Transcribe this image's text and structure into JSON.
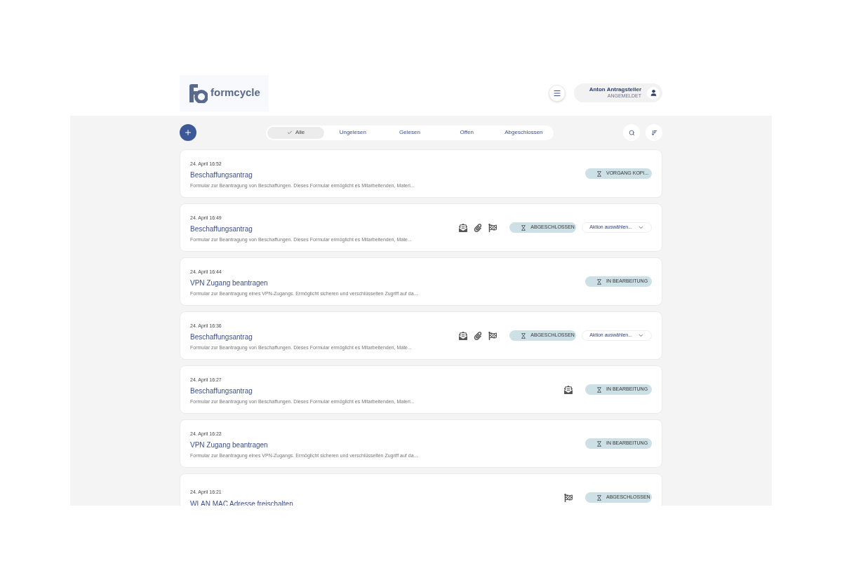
{
  "header": {
    "logo_text": "formcycle",
    "user": {
      "name": "Anton Antragsteller",
      "status": "ANGEMELDET"
    }
  },
  "filters": [
    {
      "label": "Alle",
      "selected": true
    },
    {
      "label": "Ungelesen",
      "selected": false
    },
    {
      "label": "Gelesen",
      "selected": false
    },
    {
      "label": "Offen",
      "selected": false
    },
    {
      "label": "Abgeschlossen",
      "selected": false
    }
  ],
  "entries": [
    {
      "date": "24. April 16:52",
      "title": "Beschaffungsantrag",
      "description": "Formular zur Beantragung von Beschaffungen. Dieses Formular ermöglicht es Mitarbeitenden, Materi...",
      "mail": false,
      "attachment": false,
      "flag": false,
      "status": "VORGANG KOPI..."
    },
    {
      "date": "24. April 16:49",
      "title": "Beschaffungsantrag",
      "description": "Formular zur Beantragung von Beschaffungen. Dieses Formular ermöglicht es Mitarbeitenden, Mate...",
      "mail": true,
      "attachment": true,
      "flag": true,
      "status": "ABGESCHLOSSEN",
      "action": "Aktion auswählen..."
    },
    {
      "date": "24. April 16:44",
      "title": "VPN Zugang beantragen",
      "description": "Formular zur Beantragung eines VPN-Zugangs. Ermöglicht sicheren und verschlüsselten Zugriff auf da...",
      "mail": false,
      "attachment": false,
      "flag": false,
      "status": "IN BEARBEITUNG"
    },
    {
      "date": "24. April 16:36",
      "title": "Beschaffungsantrag",
      "description": "Formular zur Beantragung von Beschaffungen. Dieses Formular ermöglicht es Mitarbeitenden, Mate...",
      "mail": true,
      "attachment": true,
      "flag": true,
      "status": "ABGESCHLOSSEN",
      "action": "Aktion auswählen..."
    },
    {
      "date": "24. April 16:27",
      "title": "Beschaffungsantrag",
      "description": "Formular zur Beantragung von Beschaffungen. Dieses Formular ermöglicht es Mitarbeitenden, Materi...",
      "mail": true,
      "attachment": false,
      "flag": false,
      "status": "IN BEARBEITUNG"
    },
    {
      "date": "24. April 16:22",
      "title": "VPN Zugang beantragen",
      "description": "Formular zur Beantragung eines VPN-Zugangs. Ermöglicht sicheren und verschlüsselten Zugriff auf da...",
      "mail": false,
      "attachment": false,
      "flag": false,
      "status": "IN BEARBEITUNG"
    },
    {
      "date": "24. April 16:21",
      "title": "WLAN MAC Adresse freischalten",
      "mail": false,
      "attachment": false,
      "flag": true,
      "status": "ABGESCHLOSSEN"
    }
  ]
}
